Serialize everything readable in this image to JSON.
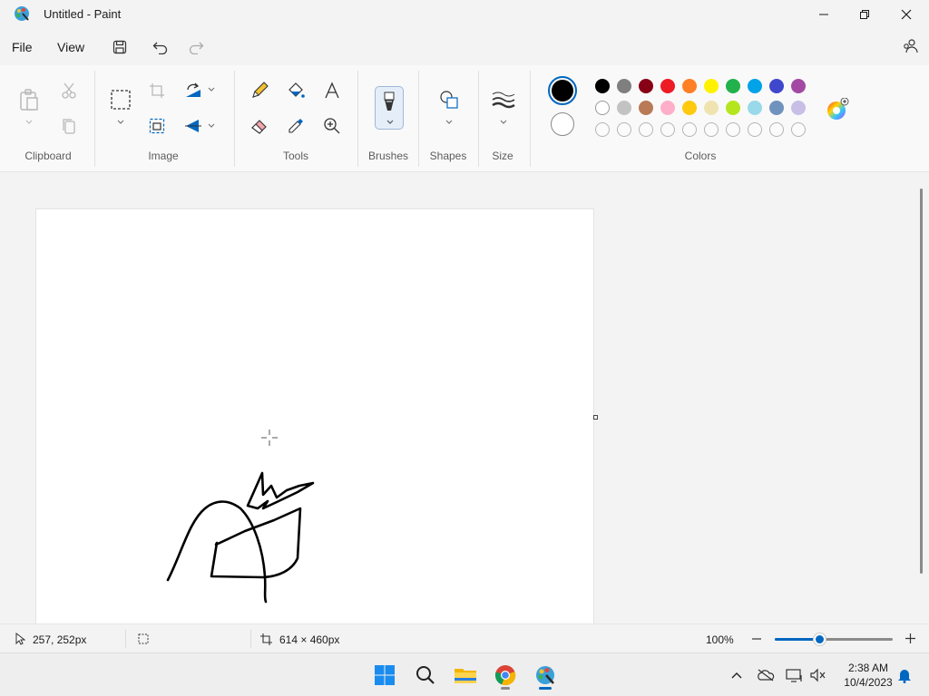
{
  "window": {
    "title": "Untitled - Paint"
  },
  "menu": {
    "file": "File",
    "view": "View"
  },
  "ribbon": {
    "groups": {
      "clipboard": "Clipboard",
      "image": "Image",
      "tools": "Tools",
      "brushes": "Brushes",
      "shapes": "Shapes",
      "size": "Size",
      "colors": "Colors"
    },
    "primary_color": "#000000",
    "secondary_color": "#ffffff",
    "palette_row1": [
      "#000000",
      "#7f7f7f",
      "#880015",
      "#ed1c24",
      "#ff7f27",
      "#fff200",
      "#22b14c",
      "#00a2e8",
      "#3f48cc",
      "#a349a4"
    ],
    "palette_row2": [
      "#ffffff",
      "#c3c3c3",
      "#b97a57",
      "#ffaec9",
      "#ffc90e",
      "#efe4b0",
      "#b5e61d",
      "#99d9ea",
      "#7092be",
      "#c8bfe7"
    ]
  },
  "status": {
    "cursor_position": "257, 252px",
    "canvas_size": "614 × 460px",
    "zoom": "100%",
    "zoom_level": 0.38
  },
  "taskbar": {
    "time": "2:38 AM",
    "date": "10/4/2023",
    "apps": [
      "start-icon",
      "search-icon",
      "file-explorer-icon",
      "chrome-icon",
      "paint-icon"
    ]
  }
}
